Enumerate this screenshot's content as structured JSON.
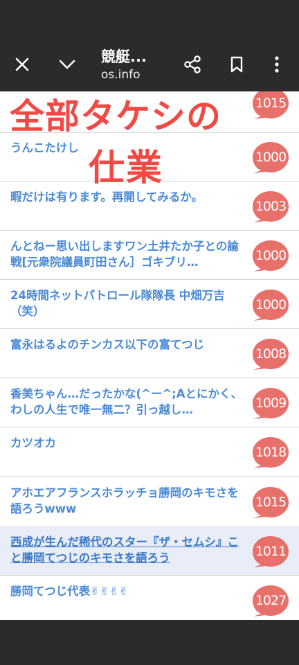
{
  "toolbar": {
    "title": "競艇...",
    "url": "os.info"
  },
  "overlay": {
    "line1": "全部タケシの",
    "line2": "仕業"
  },
  "threads": [
    {
      "title": "",
      "count": "1015"
    },
    {
      "title": "うんこたけし",
      "count": "1000"
    },
    {
      "title": "暇だけは有ります。再開してみるか。",
      "count": "1003"
    },
    {
      "title": "んとねー思い出しますワン土井たか子との論戦[元衆院議員町田さん］ゴキブリ…",
      "count": "1000"
    },
    {
      "title": "24時間ネットパトロール隊隊長 中畑万吉（笑）",
      "count": "1000"
    },
    {
      "title": "富永はるよのチンカス以下の富てつじ",
      "count": "1008"
    },
    {
      "title": "香美ちゃん…だったかな(^ー^;Aとにかく、わしの人生で唯一無二？引っ越し…",
      "count": "1009"
    },
    {
      "title": "カツオカ",
      "count": "1018"
    },
    {
      "title": "アホエアフランスホラッチョ勝岡のキモさを語ろうwww",
      "count": "1015"
    },
    {
      "title": "西成が生んだ稀代のスター『ザ・セムシ』こと勝岡てつじのキモさを語ろう",
      "count": "1011"
    },
    {
      "title": "勝岡てつじ代表✌✌✌✌",
      "count": "1027"
    }
  ],
  "colors": {
    "badge": "#e8706a",
    "link": "#4a8ad6",
    "overlay": "#f04a45",
    "bar": "#2b2b2b"
  },
  "icons": [
    "close-icon",
    "chevron-down-icon",
    "share-icon",
    "bookmark-icon",
    "more-vert-icon"
  ]
}
